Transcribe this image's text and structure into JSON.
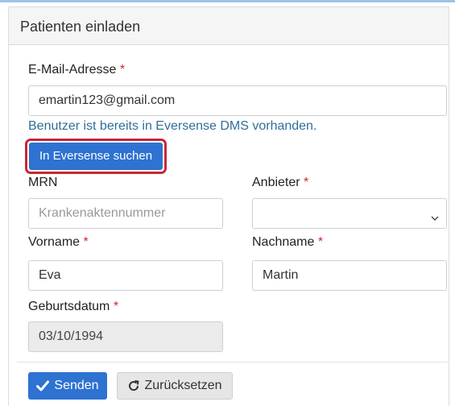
{
  "panel": {
    "title": "Patienten einladen"
  },
  "form": {
    "email": {
      "label": "E-Mail-Adresse",
      "value": "emartin123@gmail.com"
    },
    "email_message": "Benutzer ist bereits in Eversense DMS vorhanden.",
    "search_button": "In Eversense suchen",
    "mrn": {
      "label": "MRN",
      "placeholder": "Krankenaktennummer"
    },
    "provider": {
      "label": "Anbieter",
      "value": ""
    },
    "first_name": {
      "label": "Vorname",
      "value": "Eva"
    },
    "last_name": {
      "label": "Nachname",
      "value": "Martin"
    },
    "dob": {
      "label": "Geburtsdatum",
      "value": "03/10/1994"
    },
    "required_marker": "*"
  },
  "actions": {
    "send_label": "Senden",
    "reset_label": "Zurücksetzen"
  },
  "colors": {
    "primary": "#2e72d2",
    "highlight_border": "#c62833",
    "required": "#d9232d",
    "info_text": "#2f6f9a"
  },
  "icons": {
    "send": "check-icon",
    "reset": "refresh-icon",
    "select": "chevron-down-icon"
  }
}
